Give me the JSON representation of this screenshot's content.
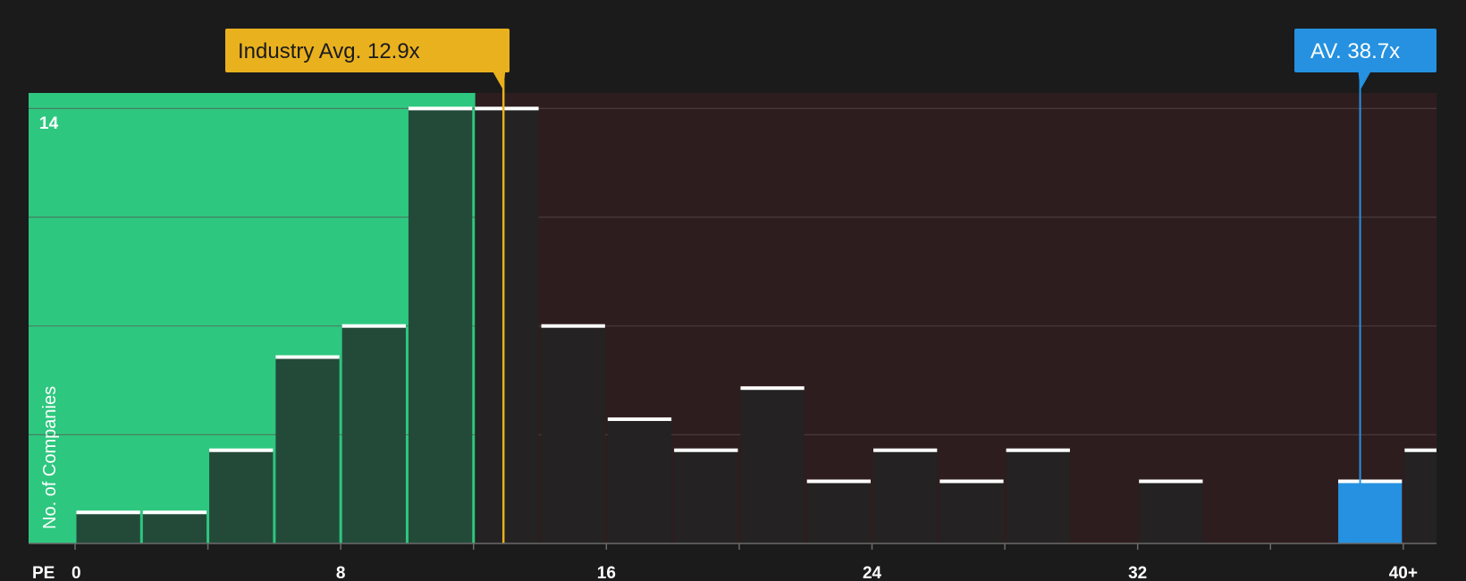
{
  "chart_data": {
    "type": "bar",
    "xlabel": "PE",
    "ylabel": "No. of Companies",
    "x_tick_labels": [
      "0",
      "8",
      "16",
      "24",
      "32",
      "40+"
    ],
    "x_tick_values": [
      0,
      8,
      16,
      24,
      32,
      40
    ],
    "y_tick_label": "14",
    "ylim": [
      0,
      14.5
    ],
    "xlim": [
      -1.4,
      41
    ],
    "bin_width": 2,
    "grid": true,
    "bins": [
      {
        "x0": 0,
        "count": 1
      },
      {
        "x0": 2,
        "count": 1
      },
      {
        "x0": 4,
        "count": 3
      },
      {
        "x0": 6,
        "count": 6
      },
      {
        "x0": 8,
        "count": 7
      },
      {
        "x0": 10,
        "count": 14
      },
      {
        "x0": 12,
        "count": 14
      },
      {
        "x0": 14,
        "count": 7
      },
      {
        "x0": 16,
        "count": 4
      },
      {
        "x0": 18,
        "count": 3
      },
      {
        "x0": 20,
        "count": 5
      },
      {
        "x0": 22,
        "count": 2
      },
      {
        "x0": 24,
        "count": 3
      },
      {
        "x0": 26,
        "count": 2
      },
      {
        "x0": 28,
        "count": 3
      },
      {
        "x0": 30,
        "count": 0
      },
      {
        "x0": 32,
        "count": 2
      },
      {
        "x0": 34,
        "count": 0
      },
      {
        "x0": 36,
        "count": 0
      },
      {
        "x0": 38,
        "count": 2,
        "highlight": true
      },
      {
        "x0": 40,
        "count": 3
      }
    ],
    "industry_avg": {
      "label": "Industry Avg. 12.9x",
      "value": 12.9
    },
    "company": {
      "label": "AV. 38.7x",
      "value": 38.7
    },
    "colors": {
      "background": "#1b1b1c",
      "green_zone": "#2ec77f",
      "red_zone": "#2e1d1f",
      "bar_green": "#234a39",
      "bar_dark": "#242222",
      "bar_highlight": "#2591e0",
      "industry": "#e9b11e",
      "company": "#2591e0",
      "grid": "#5a5050"
    }
  }
}
